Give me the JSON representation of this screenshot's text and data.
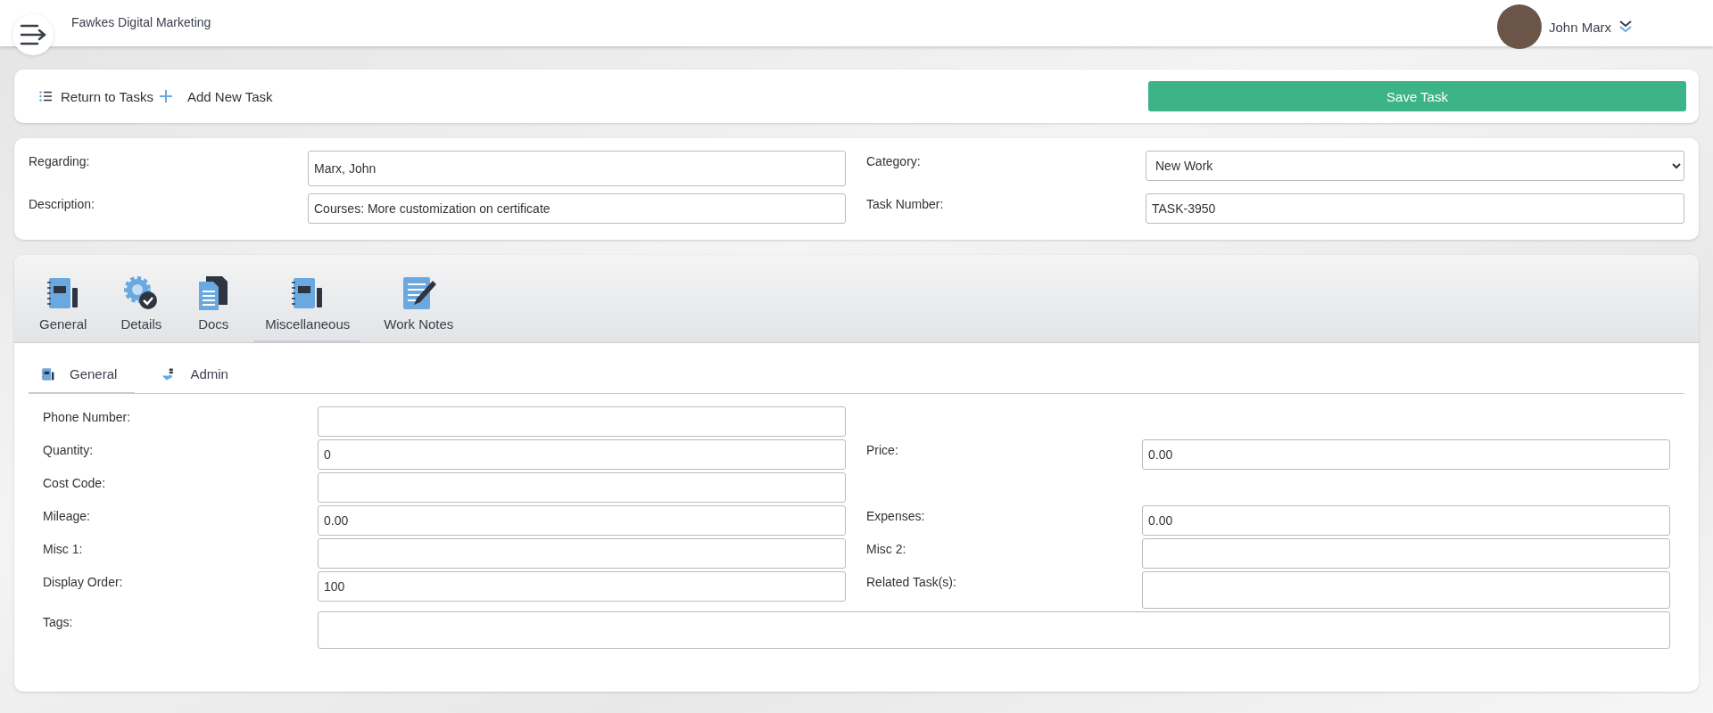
{
  "header": {
    "company": "Fawkes Digital Marketing",
    "user": "John Marx"
  },
  "toolbar": {
    "return_link": "Return to Tasks",
    "add_link": "Add New Task",
    "save_button": "Save Task"
  },
  "summary": [
    {
      "label": "Regarding:",
      "value": "Marx, John",
      "kind": "tall"
    },
    {
      "label": "Category:",
      "value": "New Work",
      "kind": "select"
    },
    {
      "label": "Description:",
      "value": "Courses: More customization on certificate",
      "kind": "line"
    },
    {
      "label": "Task Number:",
      "value": "TASK-3950",
      "kind": "line"
    }
  ],
  "tabs": [
    {
      "label": "General",
      "selected": false
    },
    {
      "label": "Details",
      "selected": false
    },
    {
      "label": "Docs",
      "selected": false
    },
    {
      "label": "Miscellaneous",
      "selected": true
    },
    {
      "label": "Work Notes",
      "selected": false
    }
  ],
  "subtabs": [
    {
      "label": "General",
      "selected": true
    },
    {
      "label": "Admin",
      "selected": false
    }
  ],
  "rows": [
    {
      "fields": [
        {
          "label": "Phone Number:",
          "kind": "line"
        }
      ]
    },
    {
      "fields": [
        {
          "label": "Quantity:",
          "value": "0",
          "kind": "line"
        },
        {
          "label": "Price:",
          "value": "0.00",
          "kind": "line"
        }
      ]
    },
    {
      "fields": [
        {
          "label": "Cost Code:",
          "kind": "line"
        }
      ]
    },
    {
      "fields": [
        {
          "label": "Mileage:",
          "value": "0.00",
          "kind": "line"
        },
        {
          "label": "Expenses:",
          "value": "0.00",
          "kind": "line"
        }
      ]
    },
    {
      "fields": [
        {
          "label": "Misc 1:",
          "kind": "line"
        },
        {
          "label": "Misc 2:",
          "kind": "line"
        }
      ]
    },
    {
      "fields": [
        {
          "label": "Display Order:",
          "value": "100",
          "kind": "line"
        },
        {
          "label": "Related Task(s):",
          "kind": "tall"
        }
      ]
    },
    {
      "fields": [
        {
          "label": "Tags:",
          "kind": "wide"
        }
      ]
    }
  ]
}
